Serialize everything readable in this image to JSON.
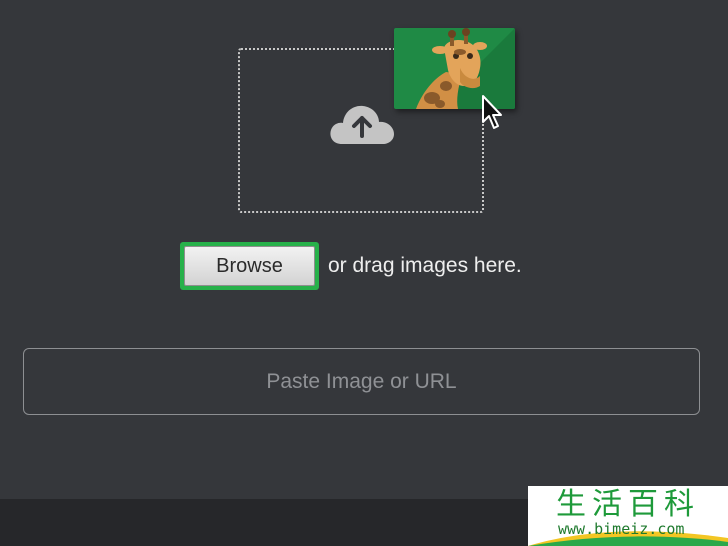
{
  "upload": {
    "browse_label": "Browse",
    "drag_text": "or drag images here."
  },
  "url_input": {
    "placeholder": "Paste Image or URL",
    "value": ""
  },
  "watermark": {
    "title": "生活百科",
    "url": "www.bimeiz.com"
  },
  "icons": {
    "cloud": "cloud-upload-icon",
    "thumbnail": "giraffe-image-thumbnail",
    "cursor": "mouse-pointer-icon"
  },
  "colors": {
    "background": "#35373b",
    "highlight": "#27b14a",
    "thumbnail_bg": "#1f8a45",
    "watermark_green": "#1e9a3a"
  }
}
